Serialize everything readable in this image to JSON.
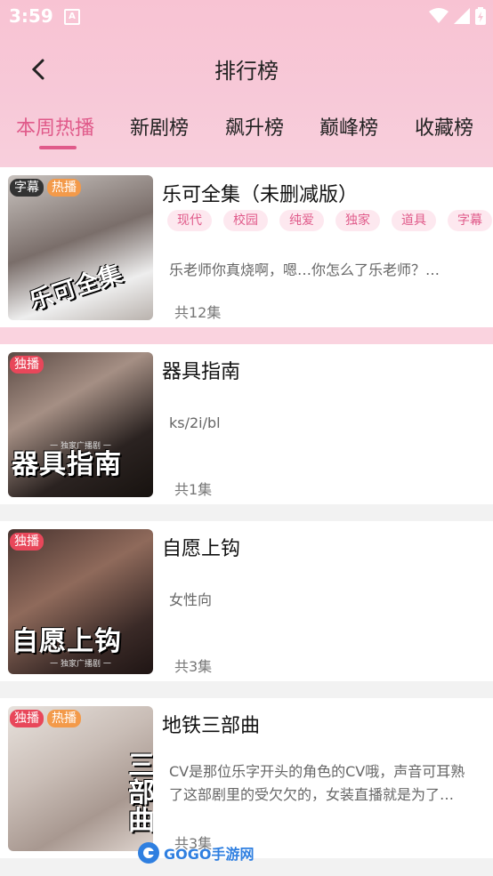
{
  "status_bar": {
    "time": "3:59"
  },
  "header": {
    "title": "排行榜"
  },
  "tabs": [
    {
      "label": "本周热播",
      "active": true
    },
    {
      "label": "新剧榜"
    },
    {
      "label": "飙升榜"
    },
    {
      "label": "巅峰榜"
    },
    {
      "label": "收藏榜"
    }
  ],
  "items": [
    {
      "title": "乐可全集（未删减版）",
      "badges": [
        "字幕",
        "热播"
      ],
      "cover_text": "乐可全集",
      "tags": [
        "现代",
        "校园",
        "纯爱",
        "独家",
        "道具",
        "字幕"
      ],
      "description": "乐老师你真烧啊，嗯…你怎么了乐老师？…",
      "episodes": "共12集"
    },
    {
      "title": "器具指南",
      "badges": [
        "独播"
      ],
      "cover_text": "器具指南",
      "cover_sub": "一 独家广播剧 一",
      "description": "ks/2i/bl",
      "episodes": "共1集"
    },
    {
      "title": "自愿上钩",
      "badges": [
        "独播"
      ],
      "cover_text": "自愿上钩",
      "cover_sub": "一 独家广播剧 一",
      "description": "女性向",
      "episodes": "共3集"
    },
    {
      "title": "地铁三部曲",
      "badges": [
        "独播",
        "热播"
      ],
      "cover_text": "三部曲",
      "description_line1": "CV是那位乐字开头的角色的CV哦，声音可耳熟",
      "description_line2": "了这部剧里的受欠欠的，女装直播就是为了…",
      "episodes": "共3集"
    }
  ],
  "watermark": {
    "text": "GOGO手游网"
  }
}
